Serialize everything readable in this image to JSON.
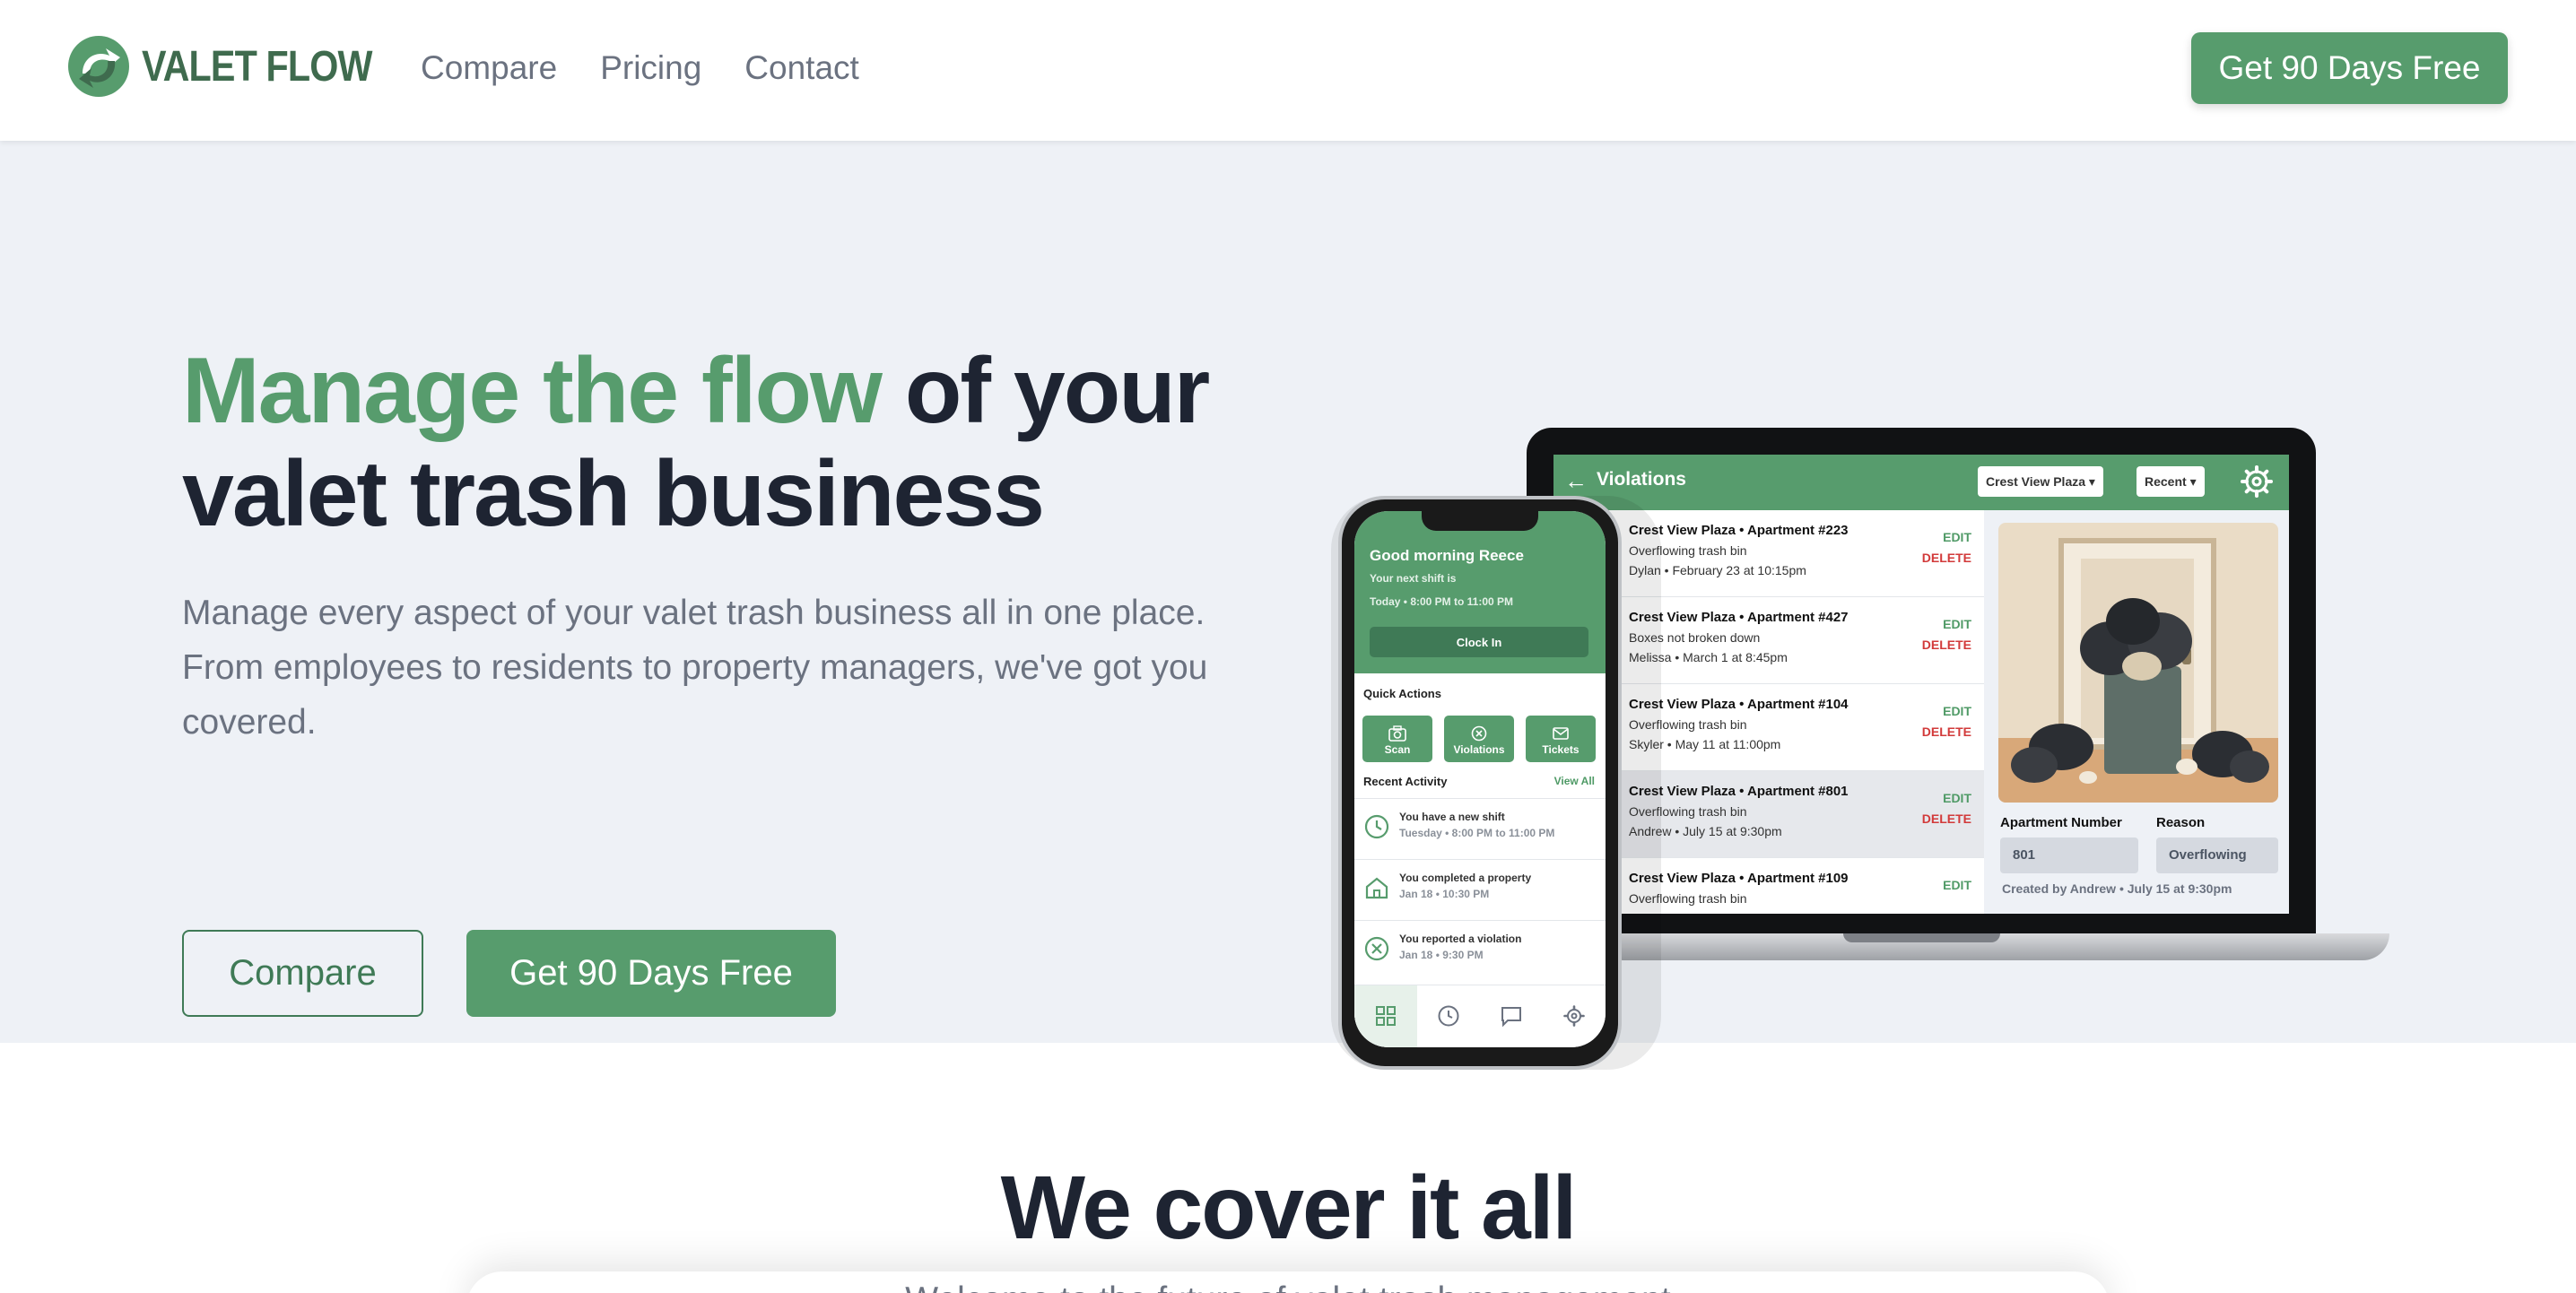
{
  "nav": {
    "brand": "VALET FLOW",
    "links": [
      "Compare",
      "Pricing",
      "Contact"
    ],
    "cta": "Get 90 Days Free"
  },
  "hero": {
    "headline_accent": "Manage the flow",
    "headline_rest": " of your valet trash business",
    "subtext": "Manage every aspect of your valet trash business all in one place. From employees to residents to property managers, we've got you covered.",
    "btn_compare": "Compare",
    "btn_free": "Get 90 Days Free"
  },
  "laptop": {
    "title": "Violations",
    "property_select": "Crest View Plaza ▾",
    "sort_select": "Recent ▾",
    "edit_label": "EDIT",
    "delete_label": "DELETE",
    "rows": [
      {
        "title": "Crest View Plaza • Apartment #223",
        "reason": "Overflowing trash bin",
        "meta": "Dylan • February 23 at 10:15pm"
      },
      {
        "title": "Crest View Plaza • Apartment #427",
        "reason": "Boxes not broken down",
        "meta": "Melissa • March 1 at 8:45pm"
      },
      {
        "title": "Crest View Plaza • Apartment #104",
        "reason": "Overflowing trash bin",
        "meta": "Skyler • May 11 at 11:00pm"
      },
      {
        "title": "Crest View Plaza • Apartment #801",
        "reason": "Overflowing trash bin",
        "meta": "Andrew • July 15 at 9:30pm"
      },
      {
        "title": "Crest View Plaza • Apartment #109",
        "reason": "Overflowing trash bin",
        "meta": ""
      }
    ],
    "detail": {
      "apt_label": "Apartment Number",
      "apt_value": "801",
      "reason_label": "Reason",
      "reason_value": "Overflowing",
      "created": "Created by Andrew • July 15 at 9:30pm"
    }
  },
  "phone": {
    "greeting": "Good morning Reece",
    "shift_line1": "Your next shift is",
    "shift_line2": "Today • 8:00 PM to 11:00 PM",
    "clock_in": "Clock In",
    "quick_actions": "Quick Actions",
    "actions": [
      "Scan",
      "Violations",
      "Tickets"
    ],
    "recent_activity": "Recent Activity",
    "view_all": "View All",
    "activity": [
      {
        "title": "You have a new shift",
        "sub": "Tuesday • 8:00 PM to 11:00 PM"
      },
      {
        "title": "You completed a property",
        "sub": "Jan 18 • 10:30 PM"
      },
      {
        "title": "You reported a violation",
        "sub": "Jan 18 • 9:30 PM"
      }
    ]
  },
  "section2": {
    "title": "We cover it all",
    "subtitle": "Welcome to the future of valet trash management"
  },
  "colors": {
    "brand_green": "#579c6d",
    "dark_green": "#3f7a56",
    "delete_red": "#d23a3a",
    "hero_bg": "#eef1f6"
  }
}
